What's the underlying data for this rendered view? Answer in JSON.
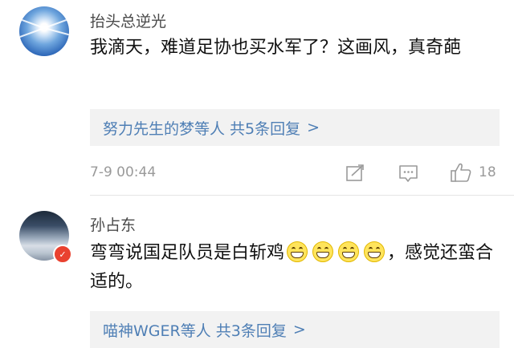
{
  "comments": [
    {
      "username": "抬头总逆光",
      "text": "我滴天，难道足协也买水军了？这画风，真奇葩",
      "replies_label": "努力先生的梦等人  共5条回复",
      "chevron": ">",
      "time": "7-9 00:44",
      "like_count": "18"
    },
    {
      "username": "孙占东",
      "badge_icon": "official-v-badge",
      "text_before": "弯弯说国足队员是白斩鸡",
      "emoji_count": 4,
      "text_after": "，感觉还蛮合适的。",
      "replies_label": "喵神WGER等人  共3条回复",
      "chevron": ">"
    }
  ],
  "colors": {
    "link_blue": "#4f7fb5",
    "meta_gray": "#9a9a9a",
    "reply_bg": "#f2f2f2",
    "badge_red": "#e9412f"
  },
  "icons": {
    "share": "share-icon",
    "comment": "comment-icon",
    "like": "thumbs-up-icon"
  }
}
